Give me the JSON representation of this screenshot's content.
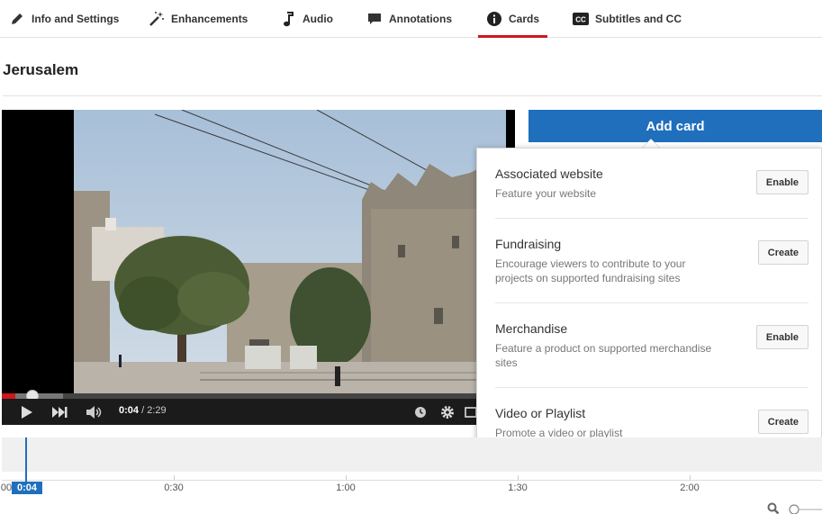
{
  "tabs": [
    {
      "label": "Info and Settings",
      "icon": "pencil-icon"
    },
    {
      "label": "Enhancements",
      "icon": "magic-wand-icon"
    },
    {
      "label": "Audio",
      "icon": "music-note-icon"
    },
    {
      "label": "Annotations",
      "icon": "speech-bubble-icon"
    },
    {
      "label": "Cards",
      "icon": "info-icon",
      "active": true
    },
    {
      "label": "Subtitles and CC",
      "icon": "cc-icon"
    }
  ],
  "video": {
    "title": "Jerusalem",
    "current_time": "0:04",
    "duration": "/ 2:29",
    "progress_fraction": 0.027
  },
  "add_card": {
    "label": "Add card"
  },
  "card_types": [
    {
      "title": "Associated website",
      "description": "Feature your website",
      "action": "Enable"
    },
    {
      "title": "Fundraising",
      "description": "Encourage viewers to contribute to your projects on supported fundraising sites",
      "action": "Create"
    },
    {
      "title": "Merchandise",
      "description": "Feature a product on supported merchandise sites",
      "action": "Enable"
    },
    {
      "title": "Video or Playlist",
      "description": "Promote a video or playlist",
      "action": "Create"
    }
  ],
  "timeline": {
    "start_label": "00",
    "playhead_label": "0:04",
    "ticks": [
      "0:30",
      "1:00",
      "1:30",
      "2:00"
    ]
  },
  "colors": {
    "accent_blue": "#1f6fbd",
    "active_tab_red": "#cc181e"
  }
}
